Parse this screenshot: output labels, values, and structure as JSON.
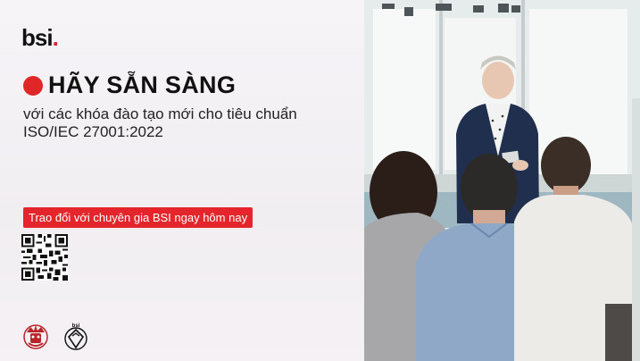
{
  "brand": {
    "logo_text": "bsi",
    "logo_dot": ".",
    "accent_color": "#e4252b"
  },
  "headline": "HÃY SẴN SÀNG",
  "subheadline_line1": "với các khóa đào tạo mới cho tiêu chuẩn",
  "subheadline_line2": "ISO/IEC 27001:2022",
  "cta_button": "Trao đổi với chuyên gia BSI ngay hôm nay",
  "icons": {
    "qr": "qr-code-icon",
    "royal_charter": "royal-charter-seal-icon",
    "kitemark": "bsi-kitemark-icon"
  },
  "kitemark_label": "bsi"
}
